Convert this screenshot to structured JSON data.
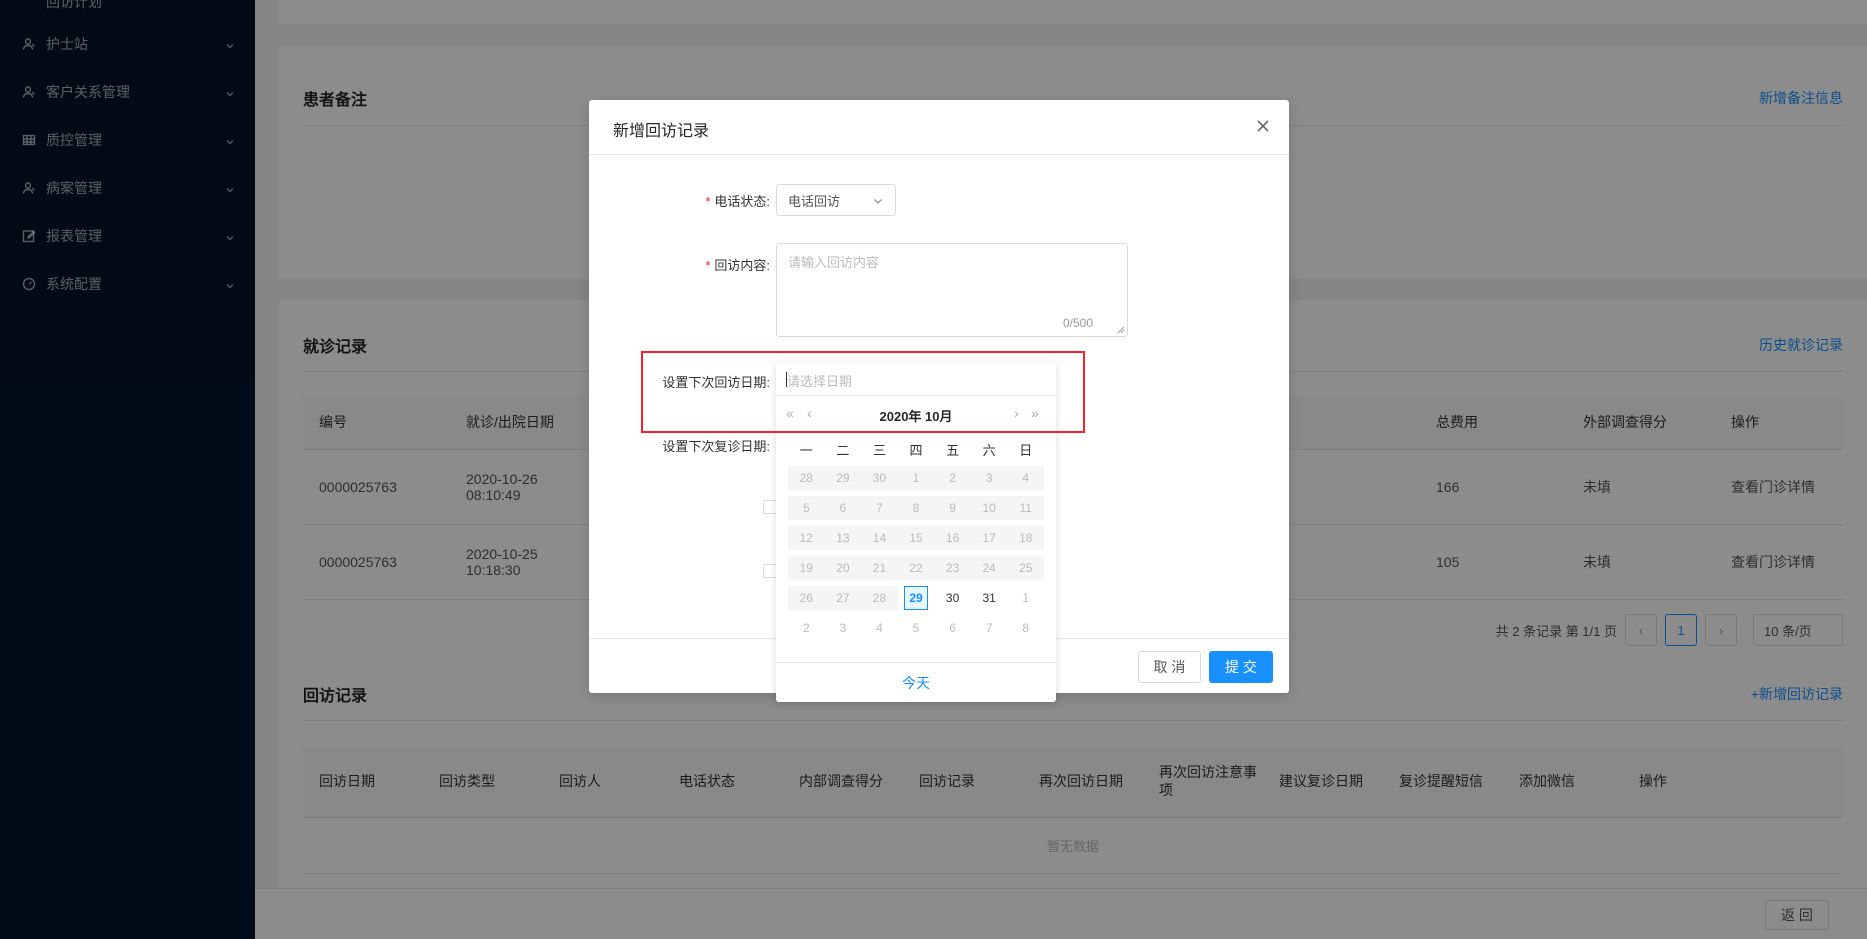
{
  "sidebar": {
    "partial_label": "回访计划",
    "items": [
      {
        "label": "护士站",
        "icon": "nurse-icon"
      },
      {
        "label": "客户关系管理",
        "icon": "users-icon"
      },
      {
        "label": "质控管理",
        "icon": "table-icon"
      },
      {
        "label": "病案管理",
        "icon": "users-icon"
      },
      {
        "label": "报表管理",
        "icon": "edit-icon"
      },
      {
        "label": "系统配置",
        "icon": "dashboard-icon"
      }
    ]
  },
  "notes_card": {
    "title": "患者备注",
    "link": "新增备注信息"
  },
  "visits_card": {
    "title": "就诊记录",
    "link": "历史就诊记录",
    "columns": [
      "编号",
      "就诊/出院日期",
      "总费用",
      "外部调查得分",
      "操作"
    ],
    "rows": [
      {
        "id": "0000025763",
        "date": "2020-10-26",
        "time": "08:10:49",
        "fee": "166",
        "score": "未填",
        "action": "查看门诊详情"
      },
      {
        "id": "0000025763",
        "date": "2020-10-25",
        "time": "10:18:30",
        "fee": "105",
        "score": "未填",
        "action": "查看门诊详情"
      }
    ],
    "pagination": {
      "summary": "共 2 条记录 第 1/1 页",
      "page": "1",
      "page_size": "10 条/页"
    }
  },
  "followup_card": {
    "title": "回访记录",
    "link": "+新增回访记录",
    "columns": [
      "回访日期",
      "回访类型",
      "回访人",
      "电话状态",
      "内部调查得分",
      "回访记录",
      "再次回访日期",
      "再次回访注意事项",
      "建议复诊日期",
      "复诊提醒短信",
      "添加微信",
      "操作"
    ],
    "empty": "暂无数据"
  },
  "footer": {
    "return_label": "返 回"
  },
  "modal": {
    "title": "新增回访记录",
    "phone_status_label": "电话状态:",
    "phone_status_value": "电话回访",
    "content_label": "回访内容:",
    "content_placeholder": "请输入回访内容",
    "content_count": "0/500",
    "next_followup_label": "设置下次回访日期:",
    "next_revisit_label": "设置下次复诊日期:",
    "cancel_label": "取 消",
    "submit_label": "提 交"
  },
  "datepicker": {
    "placeholder": "请选择日期",
    "header": "2020年 10月",
    "weekdays": [
      "一",
      "二",
      "三",
      "四",
      "五",
      "六",
      "日"
    ],
    "weeks": [
      [
        "28",
        "29",
        "30",
        "1",
        "2",
        "3",
        "4"
      ],
      [
        "5",
        "6",
        "7",
        "8",
        "9",
        "10",
        "11"
      ],
      [
        "12",
        "13",
        "14",
        "15",
        "16",
        "17",
        "18"
      ],
      [
        "19",
        "20",
        "21",
        "22",
        "23",
        "24",
        "25"
      ],
      [
        "26",
        "27",
        "28",
        "29",
        "30",
        "31",
        "1"
      ],
      [
        "2",
        "3",
        "4",
        "5",
        "6",
        "7",
        "8"
      ]
    ],
    "today_label": "今天"
  },
  "colors": {
    "primary": "#1890ff",
    "sidebar": "#001529",
    "highlight_box": "#f5222d"
  }
}
